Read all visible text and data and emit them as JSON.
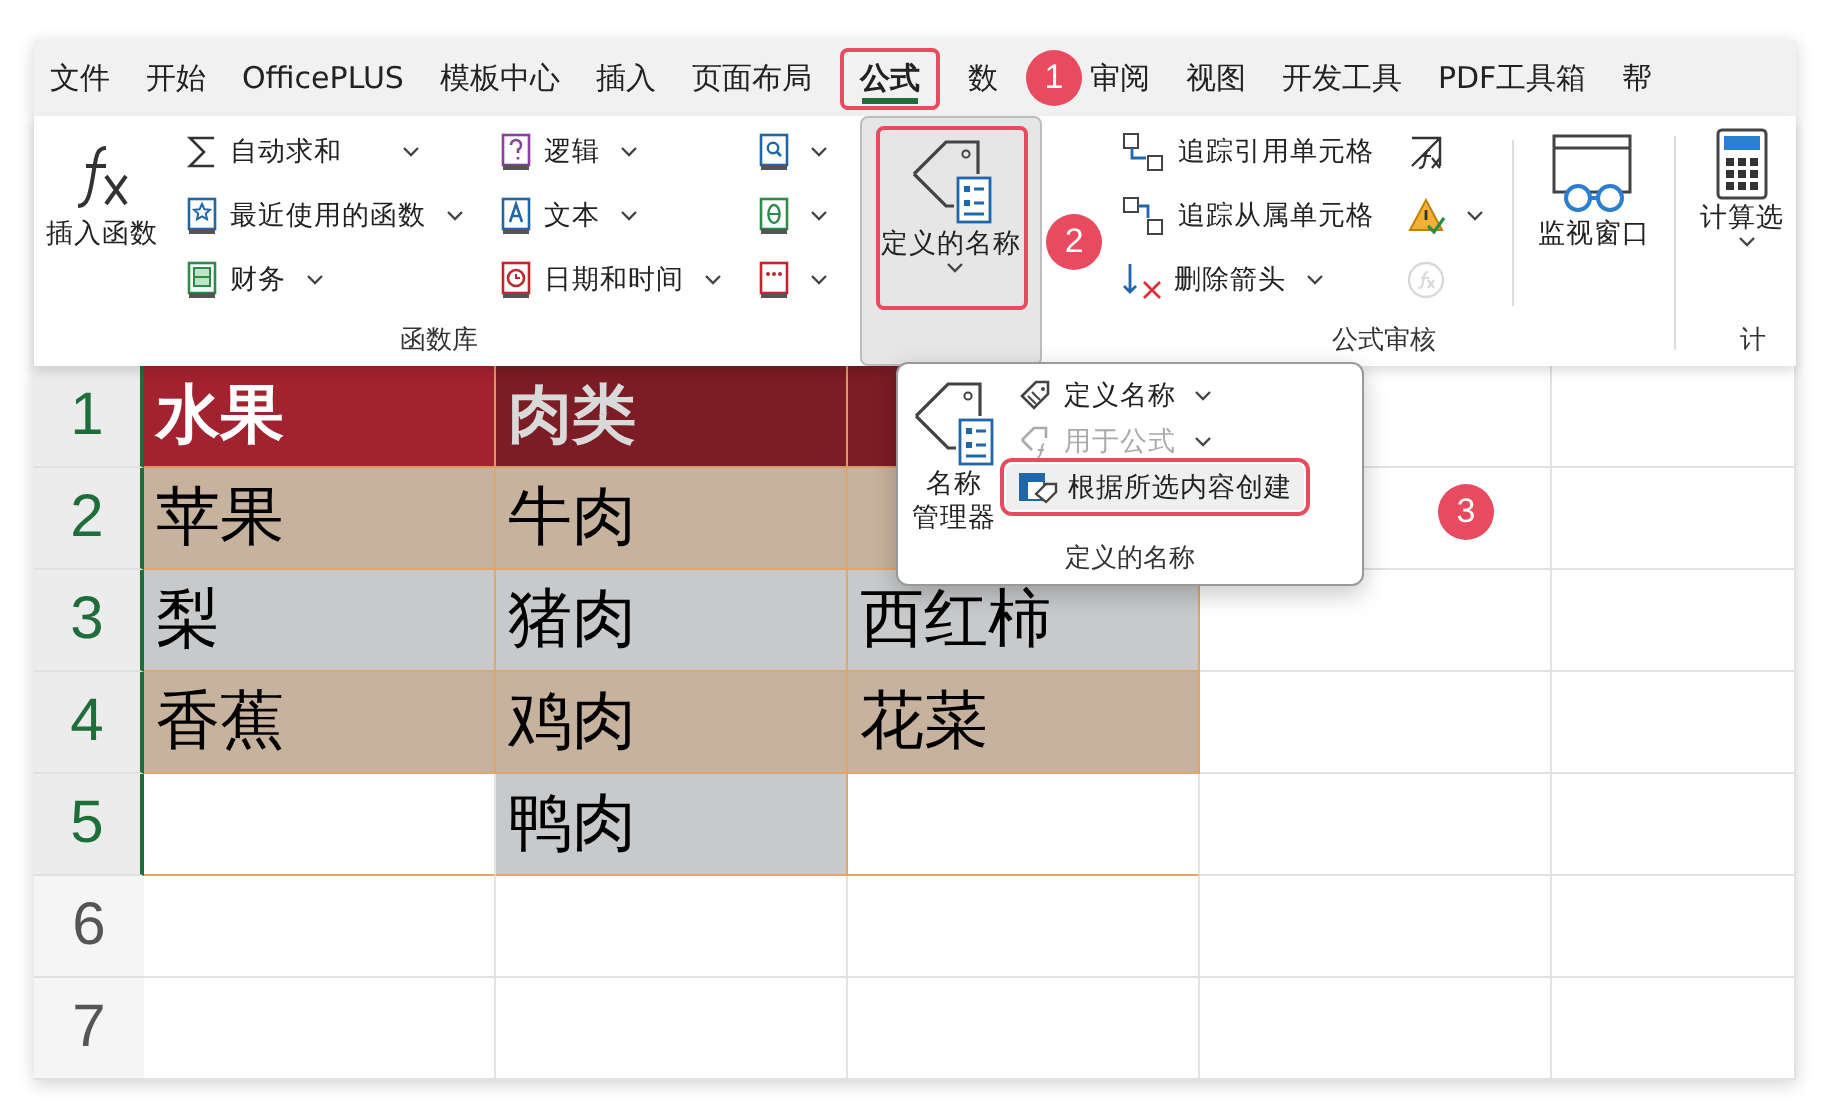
{
  "tabs": [
    {
      "label": "文件",
      "selected": false,
      "highlighted": false
    },
    {
      "label": "开始",
      "selected": false,
      "highlighted": false
    },
    {
      "label": "OfficePLUS",
      "selected": false,
      "highlighted": false
    },
    {
      "label": "模板中心",
      "selected": false,
      "highlighted": false
    },
    {
      "label": "插入",
      "selected": false,
      "highlighted": false
    },
    {
      "label": "页面布局",
      "selected": false,
      "highlighted": false
    },
    {
      "label": "公式",
      "selected": true,
      "highlighted": true
    },
    {
      "label": "数",
      "selected": false,
      "highlighted": false
    },
    {
      "label": "审阅",
      "selected": false,
      "highlighted": false
    },
    {
      "label": "视图",
      "selected": false,
      "highlighted": false
    },
    {
      "label": "开发工具",
      "selected": false,
      "highlighted": false
    },
    {
      "label": "PDF工具箱",
      "selected": false,
      "highlighted": false
    },
    {
      "label": "帮",
      "selected": false,
      "highlighted": false
    }
  ],
  "function_library": {
    "label": "函数库",
    "insert_button": "插入函数",
    "columns": [
      [
        {
          "label": "自动求和"
        },
        {
          "label": "最近使用的函数"
        },
        {
          "label": "财务"
        }
      ],
      [
        {
          "label": "逻辑"
        },
        {
          "label": "文本"
        },
        {
          "label": "日期和时间"
        }
      ]
    ]
  },
  "defined_names_button": {
    "label": "定义的名称",
    "pressed": true,
    "highlighted": true
  },
  "formula_auditing": {
    "label": "公式审核",
    "items": [
      {
        "label": "追踪引用单元格"
      },
      {
        "label": "追踪从属单元格"
      },
      {
        "label": "删除箭头"
      }
    ],
    "tools": [
      {
        "disabled": false
      },
      {
        "disabled": false
      },
      {
        "disabled": true
      }
    ],
    "watch_window": "监视窗口"
  },
  "calculation": {
    "label": "计",
    "button": "计算选"
  },
  "popup": {
    "manager_button": [
      "名称",
      "管理器"
    ],
    "label": "定义的名称",
    "items": [
      {
        "label": "定义名称",
        "disabled": false,
        "hovered": false,
        "highlighted": false
      },
      {
        "label": "用于公式",
        "disabled": true,
        "hovered": false,
        "highlighted": false
      },
      {
        "label": "根据所选内容创建",
        "disabled": false,
        "hovered": true,
        "highlighted": true
      }
    ]
  },
  "annotations": [
    {
      "label": "1"
    },
    {
      "label": "2"
    },
    {
      "label": "3"
    }
  ],
  "sheet": {
    "rows": [
      {
        "number": "1",
        "selected": true,
        "cells": [
          {
            "text": "水果",
            "kind": "header"
          },
          {
            "text": "肉类",
            "kind": "header-dark"
          },
          {
            "kind": "header-dark"
          },
          {
            "kind": "plain"
          },
          {
            "kind": "plain"
          }
        ]
      },
      {
        "number": "2",
        "selected": true,
        "cells": [
          {
            "text": "苹果",
            "kind": "tan"
          },
          {
            "text": "牛肉",
            "kind": "tan"
          },
          {
            "kind": "tan"
          },
          {
            "kind": "plain"
          },
          {
            "kind": "plain"
          }
        ]
      },
      {
        "number": "3",
        "selected": true,
        "cells": [
          {
            "text": "梨",
            "kind": "gray"
          },
          {
            "text": "猪肉",
            "kind": "gray"
          },
          {
            "text": "西红柿",
            "kind": "gray"
          },
          {
            "kind": "plain"
          },
          {
            "kind": "plain"
          }
        ]
      },
      {
        "number": "4",
        "selected": true,
        "cells": [
          {
            "text": "香蕉",
            "kind": "tan"
          },
          {
            "text": "鸡肉",
            "kind": "tan"
          },
          {
            "text": "花菜",
            "kind": "tan"
          },
          {
            "kind": "plain"
          },
          {
            "kind": "plain"
          }
        ]
      },
      {
        "number": "5",
        "selected": true,
        "cells": [
          {
            "kind": "plain-sel"
          },
          {
            "text": "鸭肉",
            "kind": "gray"
          },
          {
            "kind": "plain-sel"
          },
          {
            "kind": "plain"
          },
          {
            "kind": "plain"
          }
        ]
      },
      {
        "number": "6",
        "selected": false,
        "cells": [
          {
            "kind": "plain"
          },
          {
            "kind": "plain"
          },
          {
            "kind": "plain"
          },
          {
            "kind": "plain"
          },
          {
            "kind": "plain"
          }
        ]
      },
      {
        "number": "7",
        "selected": false,
        "cells": [
          {
            "kind": "plain"
          },
          {
            "kind": "plain"
          },
          {
            "kind": "plain"
          },
          {
            "kind": "plain"
          },
          {
            "kind": "plain"
          }
        ]
      }
    ]
  }
}
